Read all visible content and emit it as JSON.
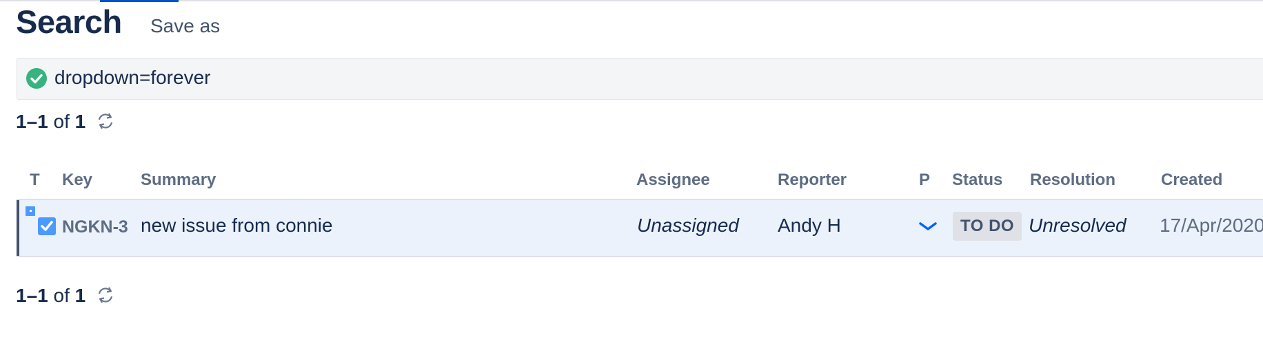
{
  "page": {
    "title": "Search",
    "save_as_label": "Save as"
  },
  "query": {
    "text": "dropdown=forever",
    "status_icon": "check-circle-icon",
    "status_color": "#36b37e"
  },
  "pagination": {
    "range": "1–1",
    "of_label": "of",
    "total": "1",
    "refresh_icon": "refresh-icon"
  },
  "table": {
    "columns": [
      "T",
      "Key",
      "Summary",
      "Assignee",
      "Reporter",
      "P",
      "Status",
      "Resolution",
      "Created"
    ],
    "rows": [
      {
        "type_icon": "task-icon",
        "key": "NGKN-3",
        "summary": "new issue from connie",
        "assignee": "Unassigned",
        "reporter": "Andy H",
        "priority_icon": "priority-low-icon",
        "status": "TO DO",
        "resolution": "Unresolved",
        "created": "17/Apr/2020"
      }
    ]
  },
  "colors": {
    "accent": "#0052cc",
    "row_highlight": "#ebf2fb",
    "text_primary": "#172b4d",
    "text_secondary": "#5e6c84"
  }
}
